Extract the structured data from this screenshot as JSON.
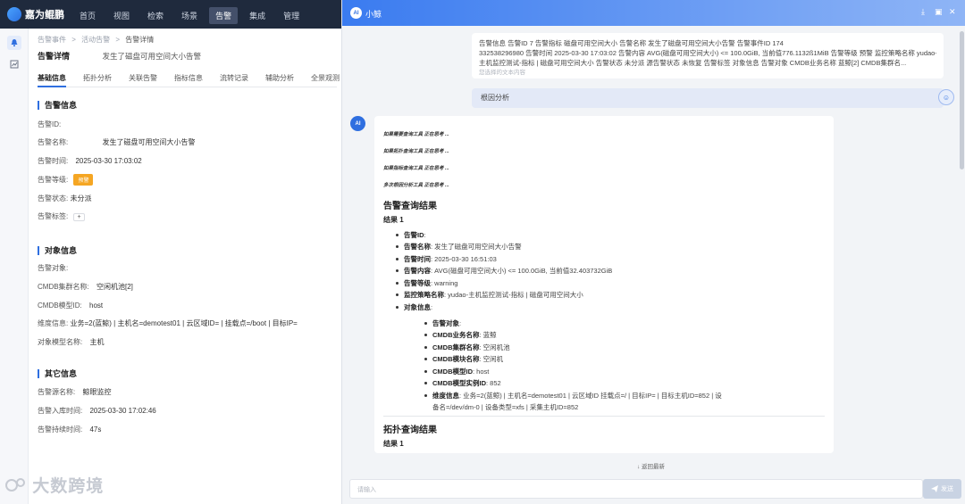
{
  "app": {
    "logo": "嘉为鲲鹏"
  },
  "topnav": [
    "首页",
    "视图",
    "检索",
    "场景",
    "告警",
    "集成",
    "管理"
  ],
  "topnav_active": 4,
  "breadcrumb": {
    "item1": "告警事件",
    "item2": "活动告警",
    "sep": ">",
    "current": "告警详情"
  },
  "page": {
    "title": "告警详情",
    "subtitle": "发生了磁盘可用空间大小告警"
  },
  "tabs": [
    "基础信息",
    "拓扑分析",
    "关联告警",
    "指标信息",
    "流转记录",
    "辅助分析",
    "全景观测"
  ],
  "sections": {
    "alert": {
      "title": "告警信息",
      "rows": [
        {
          "label": "告警ID:",
          "value": ""
        },
        {
          "label": "告警名称:",
          "value": "发生了磁盘可用空间大小告警"
        },
        {
          "label": "告警时间:",
          "value": "2025-03-30 17:03:02"
        },
        {
          "label": "告警等级:",
          "value": "预警"
        },
        {
          "label": "告警状态:",
          "value": "未分派"
        },
        {
          "label": "告警标签:",
          "value": "+"
        }
      ]
    },
    "object": {
      "title": "对象信息",
      "rows": [
        {
          "label": "告警对象:",
          "value": ""
        },
        {
          "label": "CMDB集群名称:",
          "value": "空闲机池[2]"
        },
        {
          "label": "CMDB模型ID:",
          "value": "host"
        },
        {
          "label": "维度信息:",
          "value": "业务=2(蓝鲸) | 主机名=demotest01 | 云区域ID=                  | 挂载点=/boot | 目标IP="
        },
        {
          "label": "对象模型名称:",
          "value": "主机"
        }
      ]
    },
    "other": {
      "title": "其它信息",
      "rows": [
        {
          "label": "告警源名称:",
          "value": "鲸眼监控"
        },
        {
          "label": "告警入库时间:",
          "value": "2025-03-30 17:02:46"
        },
        {
          "label": "告警持续时间:",
          "value": "47s"
        }
      ]
    }
  },
  "watermark": "大数跨境",
  "panel": {
    "ai_badge": "AI",
    "name": "小鲸",
    "user_message": {
      "line1": "告警信息 告警ID 7                                                        告警指标 磁盘可用空间大小 告警名称                            发生了磁盘可用空间大小告警 告警事件ID 174",
      "line2": "332538296980 告警时间 2025-03-30 17:03:02 告警内容 AVG(磁盘可用空间大小) <= 100.0GiB, 当前值776.1132ß1MiB 告警等级 预警 监控策略名称 yudao-",
      "line3": "主机监控测试-指标 | 磁盘可用空间大小 告警状态 未分派 源告警状态 未恢复 告警标签 对象信息 告警对象                             CMDB业务名称 蓝鲸[2] CMDB集群名...",
      "hint": "您选择的文本内容"
    },
    "user_pill": "根因分析",
    "tool_calls": [
      "如果需要查询工具 正在思考 ...",
      "如果拓扑查询工具 正在思考 ...",
      "如果指标查询工具 正在思考 ...",
      "多次根因分析工具 正在思考 ..."
    ],
    "result": {
      "heading": "告警查询结果",
      "sub": "结果 1",
      "items": [
        {
          "k": "告警ID",
          "v": ":"
        },
        {
          "k": "告警名称",
          "v": ":                   发生了磁盘可用空间大小告警"
        },
        {
          "k": "告警时间",
          "v": ": 2025-03-30 16:51:03"
        },
        {
          "k": "告警内容",
          "v": ": AVG(磁盘可用空间大小) <= 100.0GiB, 当前值32.403732GiB"
        },
        {
          "k": "告警等级",
          "v": ": warning"
        },
        {
          "k": "监控策略名称",
          "v": ": yudao-主机监控测试-指标 | 磁盘可用空间大小"
        },
        {
          "k": "对象信息",
          "v": ":"
        }
      ],
      "object_items": [
        {
          "k": "告警对象",
          "v": ":"
        },
        {
          "k": "CMDB业务名称",
          "v": ": 蓝鲸"
        },
        {
          "k": "CMDB集群名称",
          "v": ": 空闲机池"
        },
        {
          "k": "CMDB模块名称",
          "v": ": 空闲机"
        },
        {
          "k": "CMDB模型ID",
          "v": ": host"
        },
        {
          "k": "CMDB模型实例ID",
          "v": ": 852"
        },
        {
          "k": "维度信息",
          "v": ": 业务=2(蓝鲸) | 主机名=demotest01 | 云区域ID                          挂载点=/ | 目标IP=                  | 目标主机ID=852 | 设"
        }
      ],
      "dim_continued": "备名=/dev/dm-0 | 设备类型=xfs | 采集主机ID=852"
    },
    "topo": {
      "heading": "拓扑查询结果",
      "sub": "结果 1"
    },
    "back_bottom": "↓ 返回最新",
    "input_placeholder": "请输入",
    "send": "发送"
  }
}
